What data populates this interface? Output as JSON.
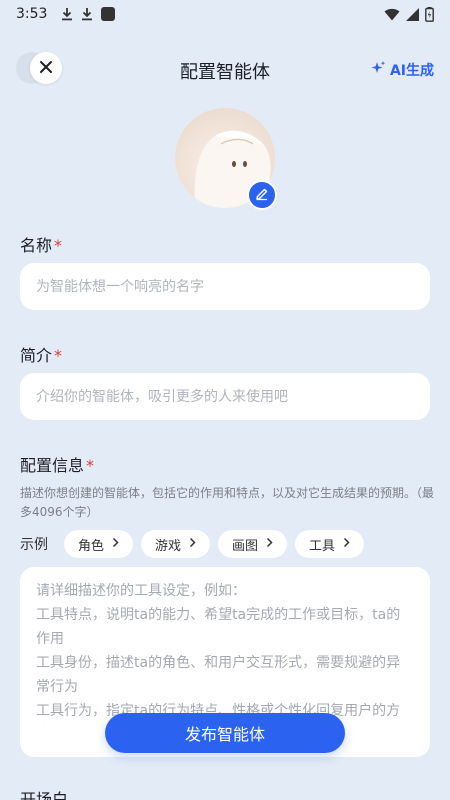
{
  "status_bar": {
    "time": "3:53"
  },
  "header": {
    "title": "配置智能体",
    "ai_generate": "AI生成"
  },
  "form": {
    "name": {
      "label": "名称",
      "required_mark": "*",
      "placeholder": "为智能体想一个响亮的名字"
    },
    "intro": {
      "label": "简介",
      "required_mark": "*",
      "placeholder": "介绍你的智能体，吸引更多的人来使用吧"
    },
    "config": {
      "label": "配置信息",
      "required_mark": "*",
      "description": "描述你想创建的智能体，包括它的作用和特点，以及对它生成结果的预期。（最多4096个字）",
      "examples_label": "示例",
      "examples": [
        "角色",
        "游戏",
        "画图",
        "工具"
      ],
      "placeholder": "请详细描述你的工具设定，例如：\n工具特点，说明ta的能力、希望ta完成的工作或目标，ta的作用\n工具身份，描述ta的角色、和用户交互形式，需要规避的异常行为\n工具行为，指定ta的行为特点、性格或个性化回复用户的方式"
    },
    "next_section_label": "开场白"
  },
  "publish_button": "发布智能体",
  "colors": {
    "accent": "#2b63f0",
    "background": "#e3ebf6",
    "required": "#e0393e"
  }
}
